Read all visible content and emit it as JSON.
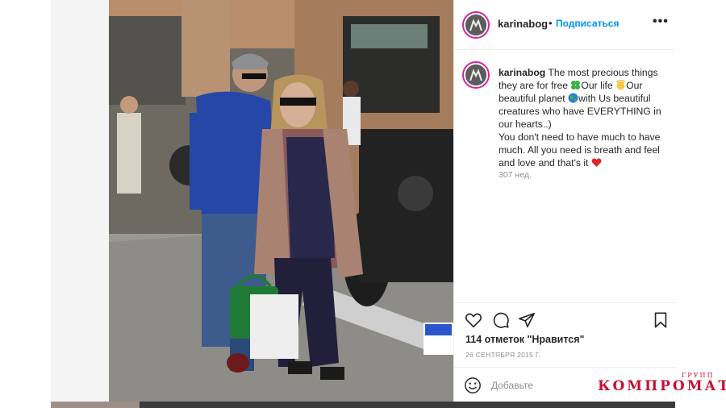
{
  "post": {
    "username": "karinabog",
    "separator": "•",
    "follow_label": "Подписаться",
    "more_label": "•••",
    "caption_user": "karinabog",
    "caption_part1": " The most precious things they are for free ",
    "caption_part2": "Our life ",
    "caption_part3": "Our beautiful planet ",
    "caption_part4": "with Us beautiful creatures who have EVERYTHING in our hearts..)",
    "caption_part5": "You don't need to have much to have much. All you need is breath and feel and love and that's it ",
    "age": "307 нед.",
    "likes": "114 отметок \"Нравится\"",
    "date": "26 СЕНТЯБРЯ 2015 Г.",
    "add_comment_placeholder": "Добавьте"
  },
  "icons": {
    "like": "heart-icon",
    "comment": "comment-icon",
    "share": "paper-plane-icon",
    "save": "bookmark-icon",
    "emoji": "smile-icon"
  },
  "watermark": {
    "text": "КОМПРОМАТ",
    "top": "ГРУПП"
  },
  "colors": {
    "follow": "#0095f6",
    "avatar_ring": "#d6249f",
    "watermark": "#c8102e"
  }
}
